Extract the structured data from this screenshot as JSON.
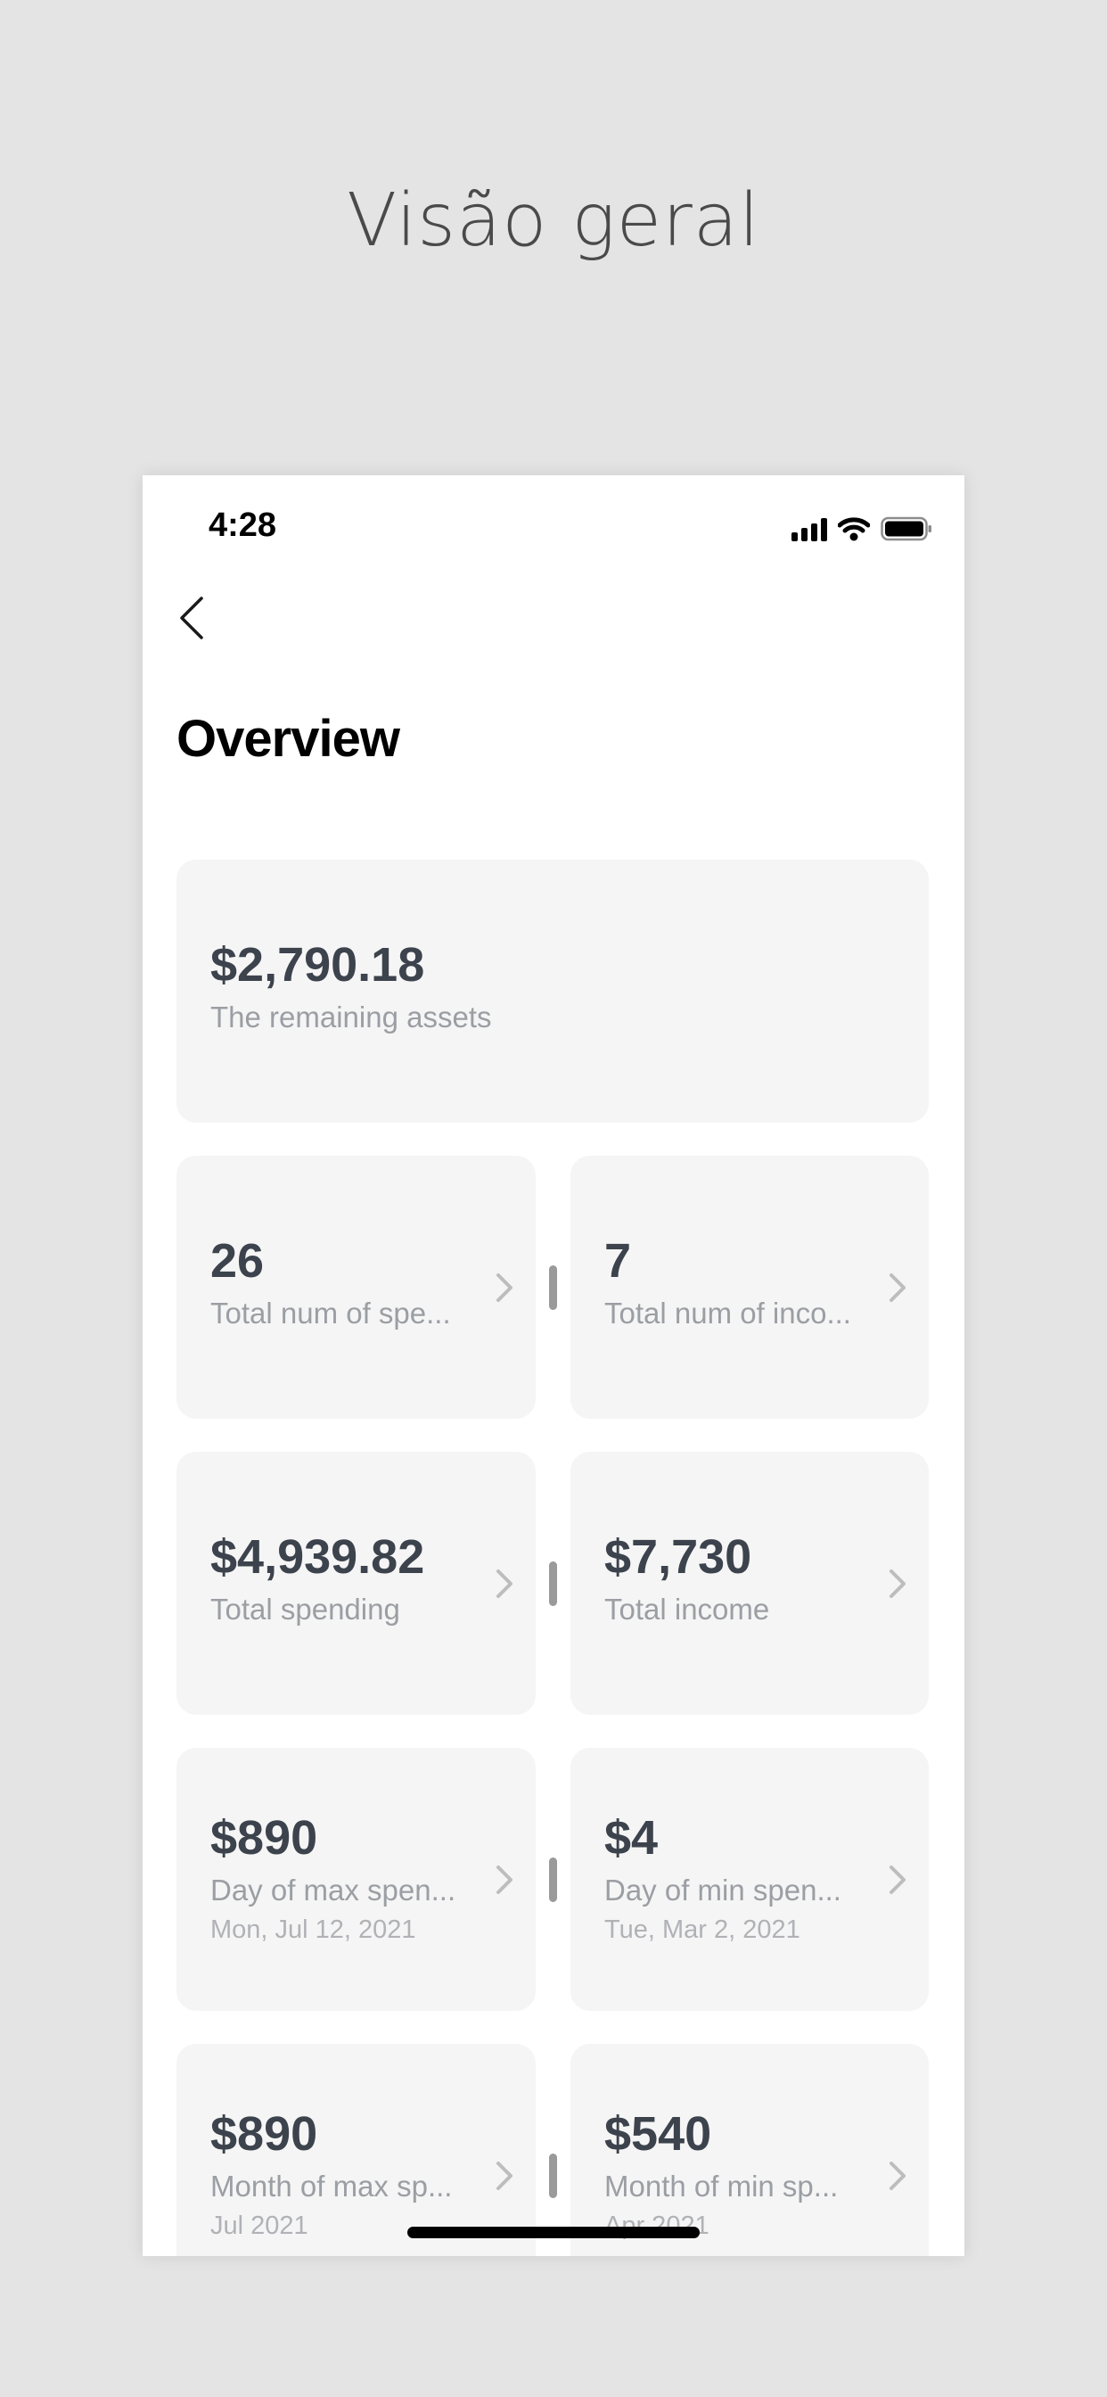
{
  "promo": {
    "title": "Visão geral"
  },
  "status_bar": {
    "time": "4:28",
    "icons": [
      "signal-icon",
      "wifi-icon",
      "battery-icon"
    ]
  },
  "nav": {
    "back_icon": "chevron-left-icon"
  },
  "page": {
    "title": "Overview"
  },
  "assets_card": {
    "value": "$2,790.18",
    "label": "The remaining assets"
  },
  "stats": [
    {
      "left": {
        "value": "26",
        "label": "Total num of spe..."
      },
      "right": {
        "value": "7",
        "label": "Total num of inco..."
      }
    },
    {
      "left": {
        "value": "$4,939.82",
        "label": "Total spending"
      },
      "right": {
        "value": "$7,730",
        "label": "Total income"
      }
    },
    {
      "left": {
        "value": "$890",
        "label": "Day of max spen...",
        "sub": "Mon, Jul 12, 2021"
      },
      "right": {
        "value": "$4",
        "label": "Day of min spen...",
        "sub": "Tue, Mar 2, 2021"
      }
    },
    {
      "left": {
        "value": "$890",
        "label": "Month of max sp...",
        "sub": "Jul 2021"
      },
      "right": {
        "value": "$540",
        "label": "Month of min sp...",
        "sub": "Apr 2021"
      }
    }
  ],
  "colors": {
    "background": "#e4e4e4",
    "card": "#f5f5f5",
    "value_text": "#3d434d",
    "label_text": "#9b9ea3"
  }
}
